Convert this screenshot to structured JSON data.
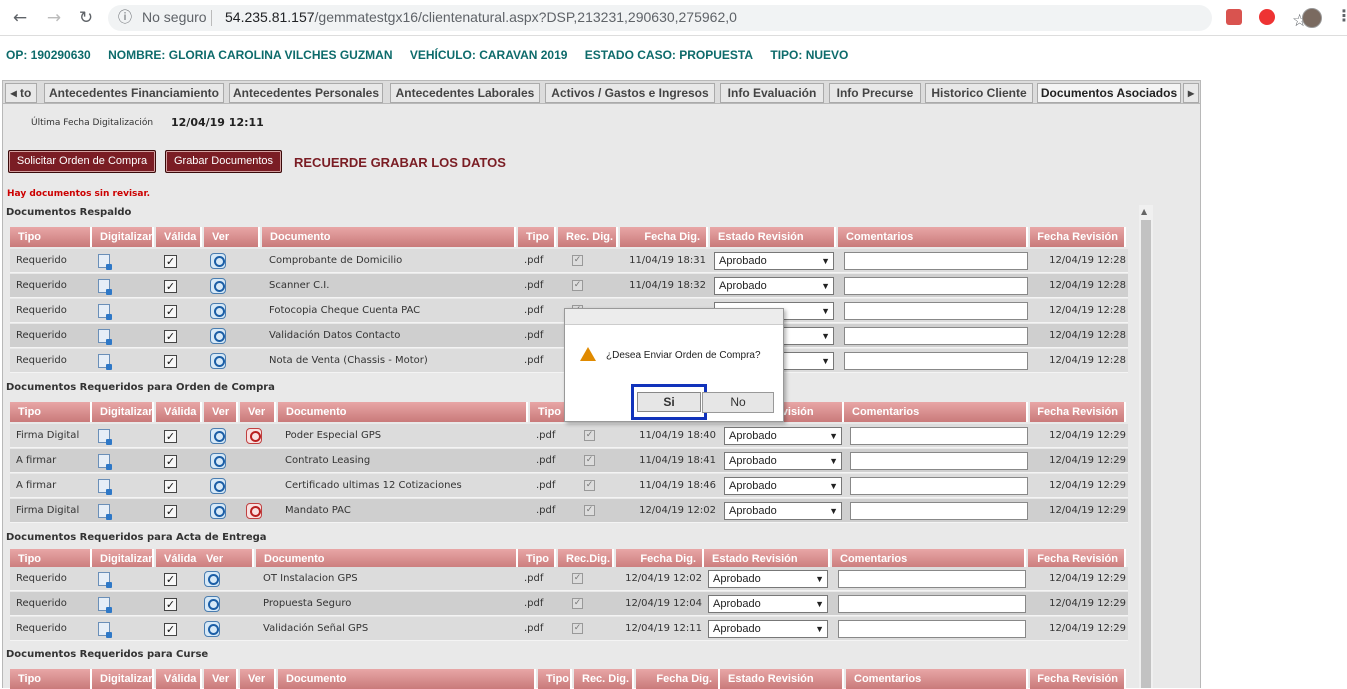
{
  "browser": {
    "back_icon": "arrow-left-icon",
    "forward_icon": "arrow-right-icon",
    "reload_icon": "reload-icon",
    "security_label": "No seguro",
    "url_host": "54.235.81.157",
    "url_path": "/gemmatestgx16/clientenatural.aspx?DSP,213231,290630,275962,0"
  },
  "header": {
    "op": "OP: 190290630",
    "nombre": "NOMBRE: GLORIA CAROLINA VILCHES GUZMAN",
    "vehiculo": "VEHÍCULO: CARAVAN 2019",
    "estado": "ESTADO CASO: PROPUESTA",
    "tipo": "TIPO: NUEVO"
  },
  "tabs": {
    "prev": "◂ to",
    "items": [
      "Antecedentes Financiamiento",
      "Antecedentes Personales",
      "Antecedentes Laborales",
      "Activos / Gastos e Ingresos",
      "Info Evaluación",
      "Info Precurse",
      "Historico Cliente",
      "Documentos Asociados"
    ],
    "next": "▸",
    "active": "Documentos Asociados"
  },
  "panel": {
    "ultima_label": "Última Fecha Digitalización",
    "ultima_value": "12/04/19 12:11",
    "btn_solicitar": "Solicitar Orden de Compra",
    "btn_grabar": "Grabar Documentos",
    "recuerde": "RECUERDE GRABAR LOS DATOS",
    "warning": "Hay documentos sin revisar."
  },
  "sections": {
    "respaldo": {
      "title": "Documentos Respaldo",
      "headers": [
        "Tipo",
        "Digitalizar",
        "Válida",
        "Ver",
        "Documento",
        "Tipo",
        "Rec. Dig.",
        "Fecha Dig.",
        "Estado Revisión",
        "Comentarios",
        "Fecha Revisión"
      ],
      "rows": [
        {
          "tipo": "Requerido",
          "doc": "Comprobante de Domicilio",
          "ext": ".pdf",
          "fecha": "11/04/19 18:31",
          "estado": "Aprobado",
          "rev": "12/04/19 12:28"
        },
        {
          "tipo": "Requerido",
          "doc": "Scanner C.I.",
          "ext": ".pdf",
          "fecha": "11/04/19 18:32",
          "estado": "Aprobado",
          "rev": "12/04/19 12:28"
        },
        {
          "tipo": "Requerido",
          "doc": "Fotocopia Cheque Cuenta PAC",
          "ext": ".pdf",
          "fecha": "",
          "estado": "",
          "rev": "12/04/19 12:28"
        },
        {
          "tipo": "Requerido",
          "doc": "Validación Datos Contacto",
          "ext": ".pdf",
          "fecha": "",
          "estado": "",
          "rev": "12/04/19 12:28"
        },
        {
          "tipo": "Requerido",
          "doc": "Nota de Venta (Chassis - Motor)",
          "ext": ".pdf",
          "fecha": "",
          "estado": "",
          "rev": "12/04/19 12:28"
        }
      ]
    },
    "orden": {
      "title": "Documentos Requeridos para Orden de Compra",
      "headers": [
        "Tipo",
        "Digitalizar",
        "Válida",
        "Ver",
        "Ver",
        "Documento",
        "Tipo",
        "Rec. Dig.",
        "Fecha Dig.",
        "Estado Revisión",
        "Comentarios",
        "Fecha Revisión"
      ],
      "rows": [
        {
          "tipo": "Firma Digital",
          "doc": "Poder Especial GPS",
          "ext": ".pdf",
          "fecha": "11/04/19 18:40",
          "estado": "Aprobado",
          "rev": "12/04/19 12:29",
          "red": true
        },
        {
          "tipo": "A firmar",
          "doc": "Contrato Leasing",
          "ext": ".pdf",
          "fecha": "11/04/19 18:41",
          "estado": "Aprobado",
          "rev": "12/04/19 12:29",
          "red": false
        },
        {
          "tipo": "A firmar",
          "doc": "Certificado ultimas 12 Cotizaciones",
          "ext": ".pdf",
          "fecha": "11/04/19 18:46",
          "estado": "Aprobado",
          "rev": "12/04/19 12:29",
          "red": false
        },
        {
          "tipo": "Firma Digital",
          "doc": "Mandato PAC",
          "ext": ".pdf",
          "fecha": "12/04/19 12:02",
          "estado": "Aprobado",
          "rev": "12/04/19 12:29",
          "red": true
        }
      ]
    },
    "acta": {
      "title": "Documentos Requeridos para Acta de Entrega",
      "headers": [
        "Tipo",
        "Digitalizar",
        "Válida",
        "Ver",
        "Documento",
        "Tipo",
        "Rec.Dig.",
        "Fecha Dig.",
        "Estado Revisión",
        "Comentarios",
        "Fecha Revisión"
      ],
      "rows": [
        {
          "tipo": "Requerido",
          "doc": "OT Instalacion GPS",
          "ext": ".pdf",
          "fecha": "12/04/19 12:02",
          "estado": "Aprobado",
          "rev": "12/04/19 12:29"
        },
        {
          "tipo": "Requerido",
          "doc": "Propuesta Seguro",
          "ext": ".pdf",
          "fecha": "12/04/19 12:04",
          "estado": "Aprobado",
          "rev": "12/04/19 12:29"
        },
        {
          "tipo": "Requerido",
          "doc": "Validación Señal GPS",
          "ext": ".pdf",
          "fecha": "12/04/19 12:11",
          "estado": "Aprobado",
          "rev": "12/04/19 12:29"
        }
      ]
    },
    "curse": {
      "title": "Documentos Requeridos para Curse",
      "headers": [
        "Tipo",
        "Digitalizar",
        "Válida",
        "Ver",
        "Ver",
        "Documento",
        "Tipo",
        "Rec. Dig.",
        "Fecha Dig.",
        "Estado Revisión",
        "Comentarios",
        "Fecha Revisión"
      ]
    }
  },
  "dialog": {
    "icon": "warning-icon",
    "message": "¿Desea Enviar Orden de Compra?",
    "yes": "Si",
    "no": "No"
  }
}
